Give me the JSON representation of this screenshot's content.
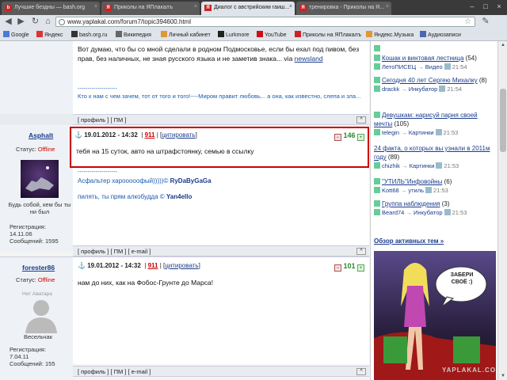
{
  "tabs": [
    {
      "label": "Лучшие бездны — bash.org",
      "active": false
    },
    {
      "label": "Приколы на ЯПлакалъ",
      "active": false
    },
    {
      "label": "Диалог с австрийским гаиш...",
      "active": true
    },
    {
      "label": "тренировка - Приколы на Я...",
      "active": false
    }
  ],
  "address": {
    "url": "www.yaplakal.com/forum7/topic394600.html"
  },
  "bookmarks": [
    "Google",
    "Яндекс",
    "bash.org.ru",
    "Википедия",
    "Личный кабинет",
    "Lurkmore",
    "YouTube",
    "Приколы на ЯПлакалъ",
    "Яндекс.Музыка",
    "Аудиозаписи"
  ],
  "post0": {
    "text": "Вот думаю, что бы со мной сделали в родном Подмосковье, если бы ехал под пивом, без прав, без наличных, не зная русского языка и не заметив знака... via ",
    "link": "newsland",
    "separator": "--------------------",
    "signature": "Кто к нам с чем зачем, тот от того и того!----Миром правит любовь... а она, как известно, слепа и зла...",
    "bar": "[ профиль ] [ ПМ ]"
  },
  "post1": {
    "author": "Asphalt",
    "status_label": "Статус:",
    "status": "Offline",
    "motto": "Будь собой, кем бы ты ни был",
    "reg_label": "Регистрация:",
    "reg_date": "14.11.06",
    "msgs_label": "Сообщений:",
    "msgs": "1595",
    "date": "19.01.2012 - 14:32",
    "num": "911",
    "quote": "цитировать",
    "rating": "146",
    "text": "тебя на 15 суток, авто на штрафстоянку, семью в ссылку",
    "sep": "--------------------",
    "sig1_a": "Асфальтер харооооофый)))))© ",
    "sig1_b": "RyDaByGaGa",
    "sig2_a": "пилять, ты прям алкобудда © ",
    "sig2_b": "Yan4ello",
    "bar": "[ профиль ] [ ПМ ]"
  },
  "post2": {
    "author": "forester86",
    "status_label": "Статус:",
    "status": "Offline",
    "avatar_label": "Нет Аватара",
    "motto": "Весельчак",
    "reg_label": "Регистрация:",
    "reg_date": "7.04.11",
    "msgs_label": "Сообщений:",
    "msgs": "155",
    "date": "19.01.2012 - 14:32",
    "num": "911",
    "quote": "цитировать",
    "rating": "101",
    "text": "нам до них, как на Фобос-Грунте до Марса!",
    "bar": "[ профиль ] [ ПМ ] [ e-mail ]"
  },
  "post0_bar_extra": "[ e-mail ]",
  "sidebar": {
    "items": [
      {
        "title": "Кошак и винтовая лестница",
        "count": "(54)",
        "user": "ЛетоПИСЕЦ",
        "section": "Видео",
        "time": "21:54"
      },
      {
        "title": "Сегодня 40 лет Сергею Михалку",
        "count": "(8)",
        "user": "drackk",
        "section": "Инкубатор",
        "time": "21:54"
      },
      {
        "title": "Девушкам: нарисуй парня своей мечты",
        "count": "(105)",
        "user": "telegin",
        "section": "Картинки",
        "time": "21:53"
      },
      {
        "title": "24 факта, о которых вы узнали в 2011м году",
        "count": "(89)",
        "user": "chizhik",
        "section": "Картинки",
        "time": "21:53"
      },
      {
        "title": "\"УТИЛЬ\"Инфовойны",
        "count": "(6)",
        "user": "Kott68",
        "section": "утиль",
        "time": "21:53"
      },
      {
        "title": "Группа наблюдения",
        "count": "(3)",
        "user": "Beard74",
        "section": "Инкубатор",
        "time": "21:53"
      }
    ],
    "overview": "Обзор активных тем »",
    "ad_text": "ЗАБЕРИ СВОЁ :)",
    "ad_brand": "YAPLAKAL.COM"
  }
}
